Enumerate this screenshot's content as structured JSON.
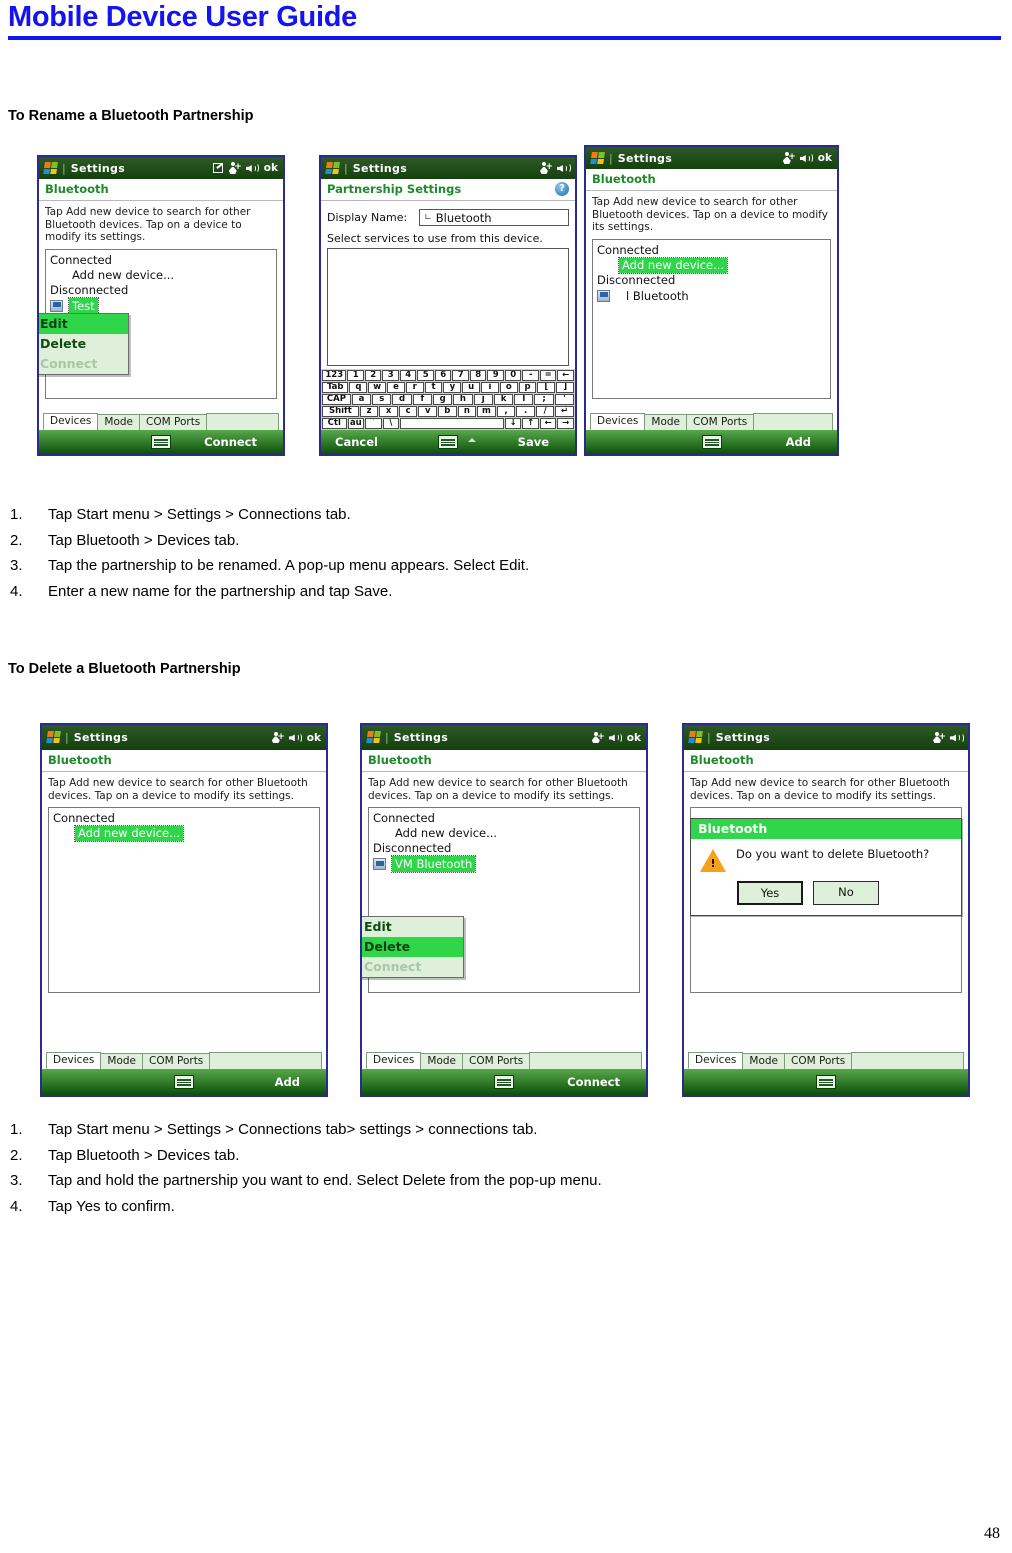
{
  "header": {
    "doc_title": "Mobile Device User Guide"
  },
  "page_number": "48",
  "sections": [
    {
      "heading": "To Rename a Bluetooth Partnership",
      "steps": [
        {
          "num": "1.",
          "text": "Tap Start menu > Settings > Connections tab."
        },
        {
          "num": "2.",
          "text": "Tap Bluetooth > Devices tab."
        },
        {
          "num": "3.",
          "text": "Tap the partnership to be renamed. A pop-up menu appears. Select Edit."
        },
        {
          "num": "4.",
          "text": "Enter a new name for the partnership and tap Save."
        }
      ]
    },
    {
      "heading": "To Delete a Bluetooth Partnership",
      "steps": [
        {
          "num": "1.",
          "text": "Tap Start menu > Settings > Connections tab> settings > connections tab."
        },
        {
          "num": "2.",
          "text": "Tap Bluetooth > Devices tab."
        },
        {
          "num": "3.",
          "text": "Tap and hold the partnership you want to end. Select Delete from the pop-up menu."
        },
        {
          "num": "4.",
          "text": "Tap Yes to confirm."
        }
      ]
    }
  ],
  "shot1": {
    "titlebar": {
      "title": "Settings",
      "ok": "ok"
    },
    "page_title": "Bluetooth",
    "instructions": "Tap Add new device to search for other Bluetooth devices. Tap on a device to modify its settings.",
    "list": {
      "connected_label": "Connected",
      "add_new_device": "Add new device...",
      "disconnected_label": "Disconnected",
      "device_name": "Test"
    },
    "ctx_menu": {
      "edit": "Edit",
      "delete": "Delete",
      "connect": "Connect"
    },
    "tabs": [
      "Devices",
      "Mode",
      "COM Ports"
    ],
    "softkey_right": "Connect"
  },
  "shot2": {
    "titlebar": {
      "title": "Settings"
    },
    "page_title": "Partnership Settings",
    "help_badge": "?",
    "display_name_label": "Display Name:",
    "display_name_value": "Bluetooth",
    "services_label": "Select services to use from this device.",
    "keyboard": {
      "row1": [
        "123",
        "1",
        "2",
        "3",
        "4",
        "5",
        "6",
        "7",
        "8",
        "9",
        "0",
        "-",
        "=",
        "←"
      ],
      "row2": [
        "Tab",
        "q",
        "w",
        "e",
        "r",
        "t",
        "y",
        "u",
        "i",
        "o",
        "p",
        "[",
        "]"
      ],
      "row3": [
        "CAP",
        "a",
        "s",
        "d",
        "f",
        "g",
        "h",
        "j",
        "k",
        "l",
        ";",
        "'"
      ],
      "row4": [
        "Shift",
        "z",
        "x",
        "c",
        "v",
        "b",
        "n",
        "m",
        ",",
        ".",
        "/",
        "↵"
      ],
      "row5": [
        "Ctl",
        "áü",
        "`",
        "\\",
        "",
        "↓",
        "↑",
        "←",
        "→"
      ]
    },
    "softkey_left": "Cancel",
    "softkey_right": "Save"
  },
  "shot3": {
    "titlebar": {
      "title": "Settings",
      "ok": "ok"
    },
    "page_title": "Bluetooth",
    "instructions": "Tap Add new device to search for other Bluetooth devices.  Tap on a device to modify its settings.",
    "list": {
      "connected_label": "Connected",
      "add_new_device": "Add new device...",
      "disconnected_label": "Disconnected",
      "device_name": "l Bluetooth"
    },
    "tabs": [
      "Devices",
      "Mode",
      "COM Ports"
    ],
    "softkey_right": "Add"
  },
  "shot4": {
    "titlebar": {
      "title": "Settings",
      "ok": "ok"
    },
    "page_title": "Bluetooth",
    "instructions": "Tap Add new device to search for other Bluetooth devices. Tap on a device to modify its settings.",
    "list": {
      "connected_label": "Connected",
      "add_new_device": "Add new device..."
    },
    "tabs": [
      "Devices",
      "Mode",
      "COM Ports"
    ],
    "softkey_right": "Add"
  },
  "shot5": {
    "titlebar": {
      "title": "Settings",
      "ok": "ok"
    },
    "page_title": "Bluetooth",
    "instructions": "Tap Add new device to search for other Bluetooth devices. Tap on a device to modify its settings.",
    "list": {
      "connected_label": "Connected",
      "add_new_device": "Add new device...",
      "disconnected_label": "Disconnected",
      "device_name": "VM Bluetooth"
    },
    "ctx_menu": {
      "edit": "Edit",
      "delete": "Delete",
      "connect": "Connect"
    },
    "tabs": [
      "Devices",
      "Mode",
      "COM Ports"
    ],
    "softkey_right": "Connect"
  },
  "shot6": {
    "titlebar": {
      "title": "Settings"
    },
    "page_title": "Bluetooth",
    "instructions": "Tap Add new device to search for other Bluetooth devices. Tap on a device to modify its settings.",
    "dialog": {
      "title": "Bluetooth",
      "message": "Do you want to delete Bluetooth?",
      "yes": "Yes",
      "no": "No"
    },
    "tabs": [
      "Devices",
      "Mode",
      "COM Ports"
    ]
  },
  "colors": {
    "brand_blue": "#1414f0",
    "ppc_green_dark": "#16450f",
    "ppc_green_light": "#2fd64a",
    "tab_green": "#dff0da"
  }
}
